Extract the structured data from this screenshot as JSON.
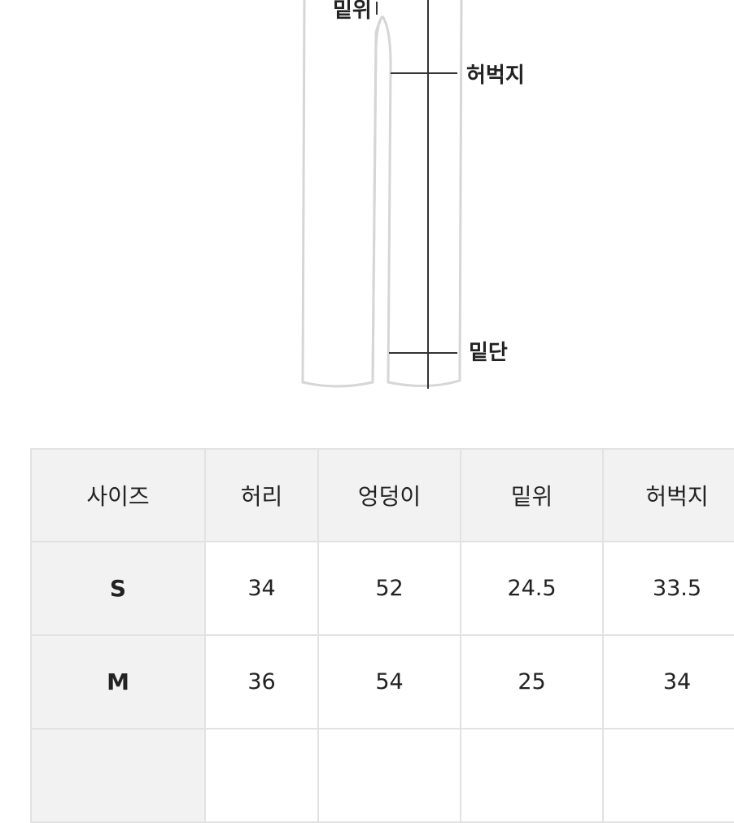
{
  "diagram": {
    "labels": {
      "rise": "밑위",
      "thigh": "허벅지",
      "hem": "밑단"
    }
  },
  "table": {
    "headers": [
      "사이즈",
      "허리",
      "엉덩이",
      "밑위",
      "허벅지"
    ],
    "rows": [
      {
        "size": "S",
        "waist": "34",
        "hip": "52",
        "rise": "24.5",
        "thigh": "33.5"
      },
      {
        "size": "M",
        "waist": "36",
        "hip": "54",
        "rise": "25",
        "thigh": "34"
      },
      {
        "size": "",
        "waist": "",
        "hip": "",
        "rise": "",
        "thigh": ""
      }
    ]
  }
}
